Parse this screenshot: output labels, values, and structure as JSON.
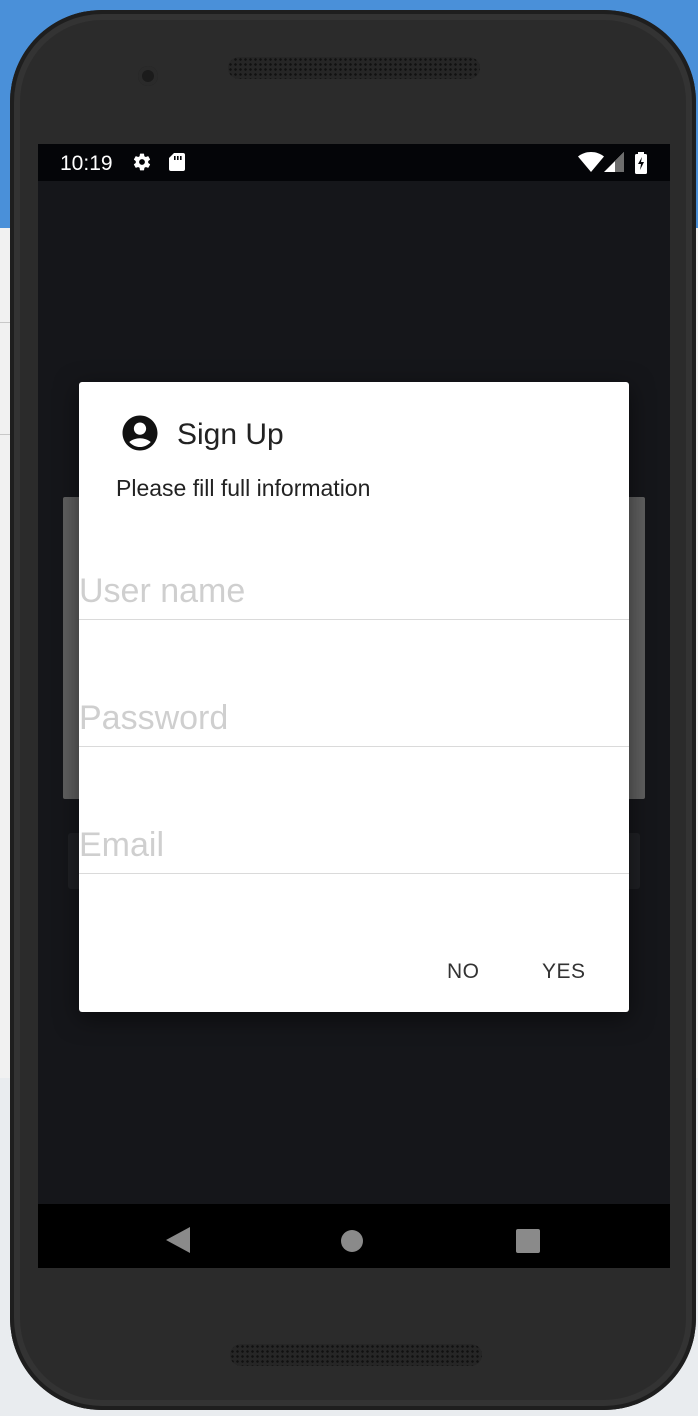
{
  "status_bar": {
    "time": "10:19",
    "icons": [
      "gear-icon",
      "sd-card-icon",
      "wifi-icon",
      "signal-icon",
      "battery-charging-icon"
    ]
  },
  "dialog": {
    "title": "Sign Up",
    "title_icon": "account-circle-icon",
    "message": "Please fill full information",
    "fields": [
      {
        "name": "username",
        "value": "",
        "placeholder": "User name"
      },
      {
        "name": "password",
        "value": "",
        "placeholder": "Password"
      },
      {
        "name": "email",
        "value": "",
        "placeholder": "Email"
      }
    ],
    "buttons": {
      "negative": "NO",
      "positive": "YES"
    }
  },
  "nav_bar": {
    "icons": [
      "back-triangle-icon",
      "home-circle-icon",
      "recents-square-icon"
    ]
  },
  "colors": {
    "desktop_accent": "#4a90d9",
    "screen_background": "#15161a",
    "dialog_background": "#ffffff",
    "placeholder_text": "#cfcfcf"
  }
}
